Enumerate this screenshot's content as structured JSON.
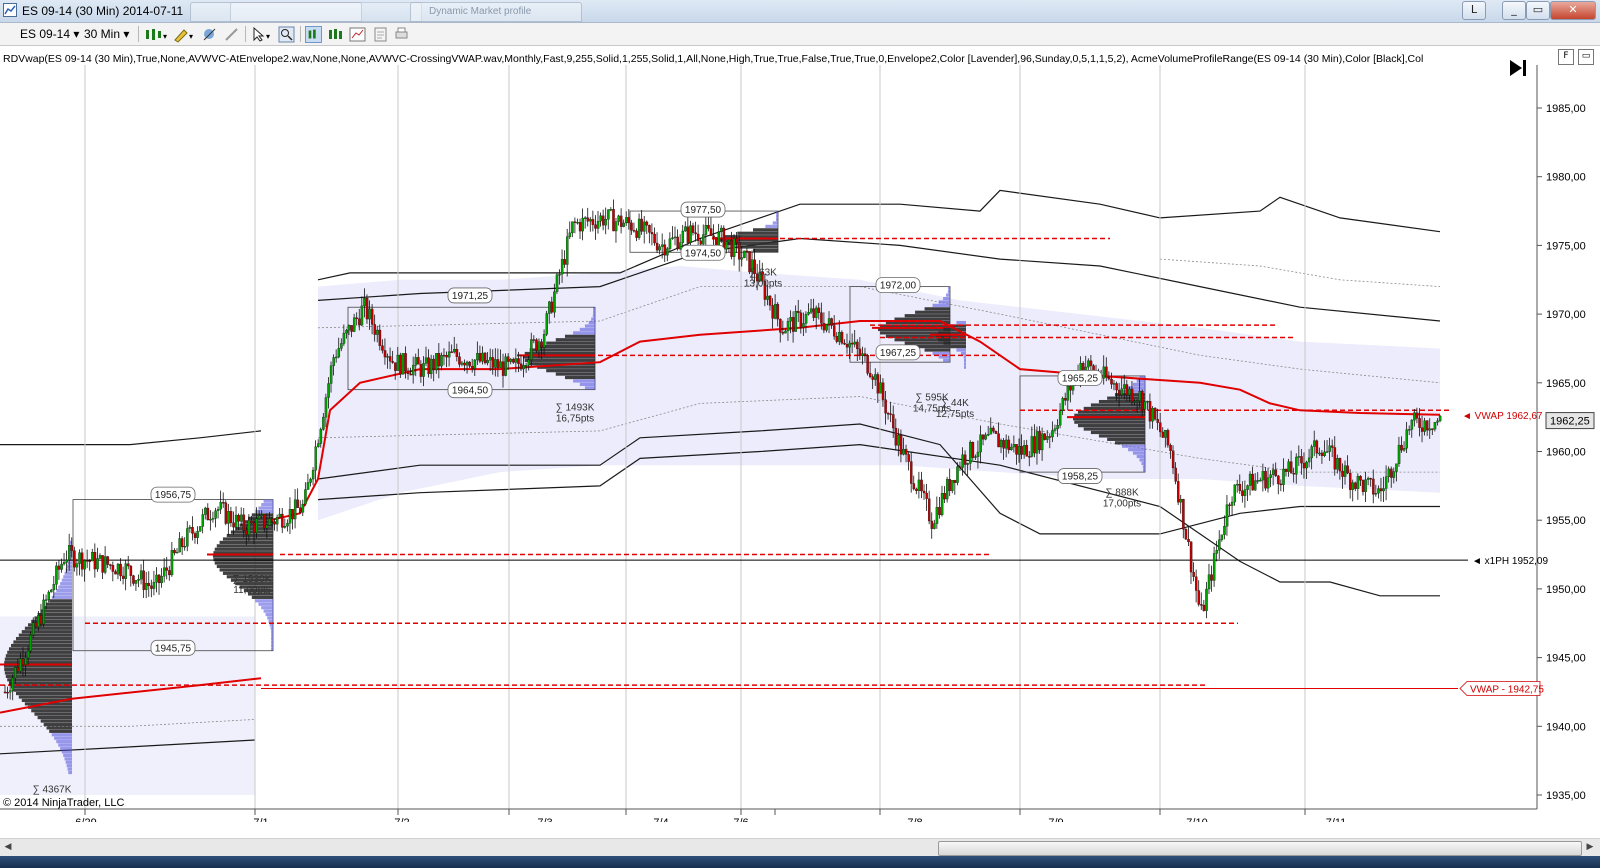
{
  "window": {
    "title": "ES 09-14 (30 Min)  2014-07-11",
    "ghost_tab_1": "Dynamic Market profile",
    "btn_layout": "L",
    "btn_minimize": "_",
    "btn_restore": "▭",
    "btn_close": "✕"
  },
  "toolbar": {
    "instrument": "ES 09-14",
    "interval": "30 Min"
  },
  "chart": {
    "indicator_text": "RDVwap(ES 09-14 (30 Min),True,None,AVWVC-AtEnvelope2.wav,None,None,AVWVC-CrossingVWAP.wav,Monthly,Fast,9,255,Solid,1,255,Solid,1,All,None,High,True,True,False,True,True,0,Envelope2,Color [Lavender],96,Sunday,0,5,1,1,5,2), AcmeVolumeProfileRange(ES 09-14 (30 Min),Color [Black],Col",
    "copyright": "© 2014 NinjaTrader, LLC",
    "price_axis": [
      "1985,00",
      "1980,00",
      "1975,00",
      "1970,00",
      "1965,00",
      "1960,00",
      "1955,00",
      "1950,00",
      "1945,00",
      "1940,00",
      "1935,00"
    ],
    "date_axis": [
      "6/29",
      "7/1",
      "7/2",
      "7/3",
      "7/4",
      "7/6",
      "7/8",
      "7/9",
      "7/10",
      "7/11"
    ],
    "last_price": "1962,25",
    "vwap_current_label": "◄ VWAP  1962,67",
    "vwap_prior_label": "VWAP - 1942,75",
    "prior_high_label": "◄ x1PH 1952,09",
    "profile_labels": [
      "1956,75",
      "1945,75",
      "1971,25",
      "1964,50",
      "1977,50",
      "1974,50",
      "1972,00",
      "1967,25",
      "1965,25",
      "1958,25"
    ],
    "volume_labels": [
      {
        "sum": "∑ 1530K",
        "pts": "11,00pts"
      },
      {
        "sum": "∑ 1493K",
        "pts": "16,75pts"
      },
      {
        "sum": "∑ 63K",
        "pts": "13,00pts"
      },
      {
        "sum": "∑ 595K",
        "pts": "14,75pts"
      },
      {
        "sum": "∑ 44K",
        "pts": "12,75pts"
      },
      {
        "sum": "∑ 888K",
        "pts": "17,00pts"
      },
      {
        "sum": "∑ 4367K",
        "pts": ""
      }
    ],
    "colors": {
      "vwap": "#e00000",
      "envelope": "#1a1a1a",
      "band_fill": "#e9e9fb",
      "profile_dark": "#2b2b2b",
      "profile_blue": "#5a5ae0",
      "bull": "#00a000",
      "bear": "#c00000"
    }
  },
  "chart_data": {
    "type": "candlestick",
    "instrument": "ES 09-14",
    "interval": "30 Min",
    "close_series": [
      1942.5,
      1947.0,
      1952.5,
      1952.0,
      1951.5,
      1950.0,
      1953.5,
      1956.0,
      1954.5,
      1955.0,
      1956.0,
      1967.0,
      1970.5,
      1966.5,
      1966.0,
      1967.0,
      1966.5,
      1966.0,
      1968.5,
      1976.5,
      1977.0,
      1976.5,
      1975.0,
      1976.0,
      1975.5,
      1973.5,
      1969.0,
      1970.0,
      1968.5,
      1966.0,
      1960.0,
      1955.0,
      1959.5,
      1961.0,
      1960.0,
      1961.5,
      1966.5,
      1965.0,
      1964.0,
      1960.0,
      1948.0,
      1957.0,
      1958.0,
      1958.5,
      1960.5,
      1958.0,
      1957.0,
      1962.0,
      1962.25
    ],
    "vwap_monthly": 1962.67,
    "vwap_prior": 1942.75,
    "prior_high": 1952.09,
    "last": 1962.25,
    "ylim": [
      1933.5,
      1988.0
    ]
  }
}
